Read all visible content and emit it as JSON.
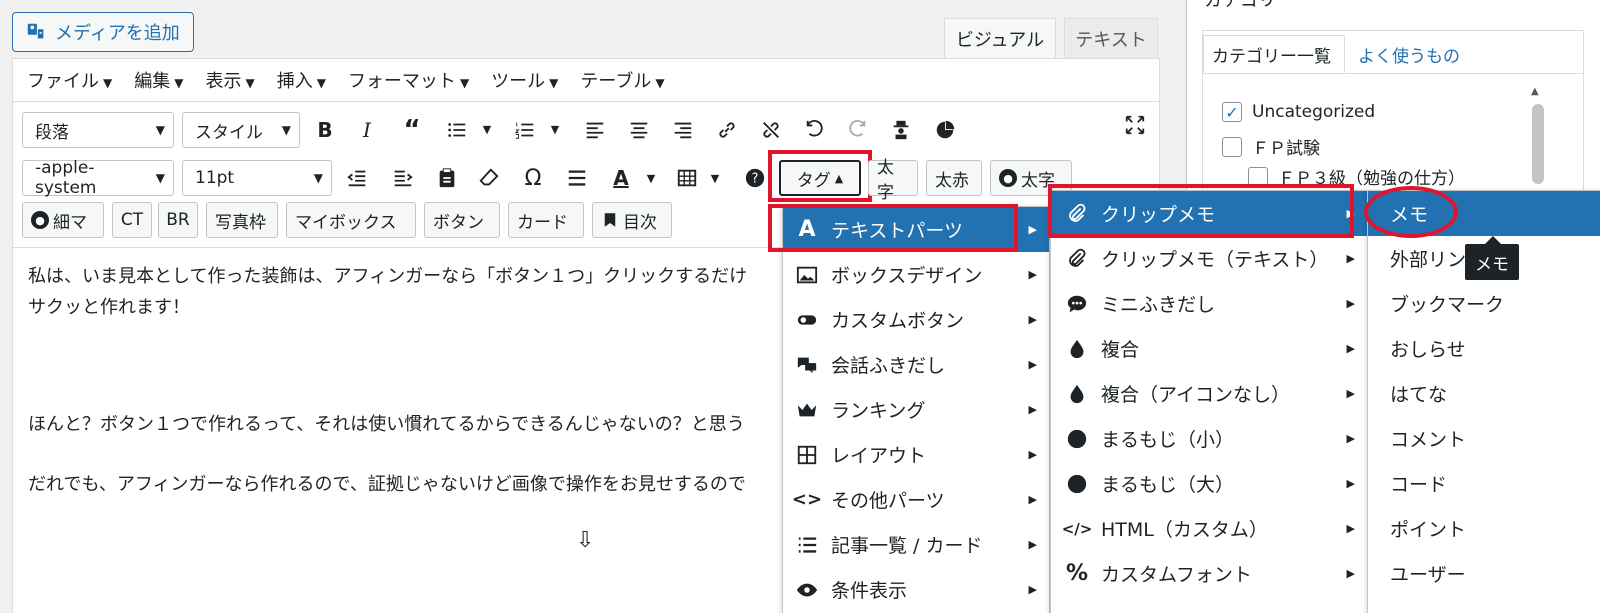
{
  "media_button": {
    "label": "メディアを追加"
  },
  "editor_tabs": [
    {
      "label": "ビジュアル",
      "active": true
    },
    {
      "label": "テキスト",
      "active": false
    }
  ],
  "menubar": [
    {
      "label": "ファイル"
    },
    {
      "label": "編集"
    },
    {
      "label": "表示"
    },
    {
      "label": "挿入"
    },
    {
      "label": "フォーマット"
    },
    {
      "label": "ツール"
    },
    {
      "label": "テーブル"
    }
  ],
  "toolbar": {
    "paragraph_select": "段落",
    "style_select": "スタイル",
    "font_select": "-apple-system",
    "size_select": "11pt",
    "tag_button": "タグ",
    "quick_row2": [
      "太字",
      "太赤",
      "太字"
    ],
    "quick_row3": [
      "細マ",
      "CT",
      "BR",
      "写真枠",
      "マイボックス",
      "ボタン",
      "カード",
      "目次"
    ]
  },
  "content": {
    "line1": "私は、いま見本として作った装飾は、アフィンガーなら「ボタン１つ」クリックするだけ",
    "line2": "サクッと作れます！",
    "line3": "ほんと？ボタン１つで作れるって、それは使い慣れてるからできるんじゃないの？と思う",
    "line4": "だれでも、アフィンガーなら作れるので、証拠じゃないけど画像で操作をお見せするので",
    "arrow": "⇩"
  },
  "sidebar": {
    "title": "カテゴリー",
    "tabs": [
      {
        "label": "カテゴリー一覧",
        "active": true
      },
      {
        "label": "よく使うもの",
        "active": false
      }
    ],
    "categories": [
      {
        "label": "Uncategorized",
        "checked": true
      },
      {
        "label": "ＦＰ試験",
        "checked": false
      },
      {
        "label": "ＦＰ３級（勉強の仕方）",
        "checked": false
      }
    ]
  },
  "menu1": [
    {
      "label": "テキストパーツ",
      "icon": "letter-a-icon",
      "highlighted": true
    },
    {
      "label": "ボックスデザイン",
      "icon": "image-box-icon"
    },
    {
      "label": "カスタムボタン",
      "icon": "toggle-icon"
    },
    {
      "label": "会話ふきだし",
      "icon": "chat-bubbles-icon"
    },
    {
      "label": "ランキング",
      "icon": "crown-icon"
    },
    {
      "label": "レイアウト",
      "icon": "grid-icon"
    },
    {
      "label": "その他パーツ",
      "icon": "code-brackets-icon"
    },
    {
      "label": "記事一覧 / カード",
      "icon": "list-icon"
    },
    {
      "label": "条件表示",
      "icon": "eye-icon"
    }
  ],
  "menu2": [
    {
      "label": "クリップメモ",
      "icon": "paperclip-icon",
      "highlighted": true
    },
    {
      "label": "クリップメモ（テキスト）",
      "icon": "paperclip-icon"
    },
    {
      "label": "ミニふきだし",
      "icon": "speech-bubble-icon"
    },
    {
      "label": "複合",
      "icon": "drop-icon"
    },
    {
      "label": "複合（アイコンなし）",
      "icon": "drop-icon"
    },
    {
      "label": "まるもじ（小）",
      "icon": "circle-icon"
    },
    {
      "label": "まるもじ（大）",
      "icon": "circle-icon"
    },
    {
      "label": "HTML（カスタム）",
      "icon": "code-slash-icon"
    },
    {
      "label": "カスタムフォント",
      "icon": "percent-icon"
    }
  ],
  "menu3": [
    {
      "label": "メモ",
      "highlighted": true
    },
    {
      "label": "外部リンク"
    },
    {
      "label": "ブックマーク"
    },
    {
      "label": "おしらせ"
    },
    {
      "label": "はてな"
    },
    {
      "label": "コメント"
    },
    {
      "label": "コード"
    },
    {
      "label": "ポイント"
    },
    {
      "label": "ユーザー"
    }
  ],
  "tooltip": "メモ",
  "colors": {
    "accent": "#2271b1",
    "highlight_red": "#e0142a"
  }
}
